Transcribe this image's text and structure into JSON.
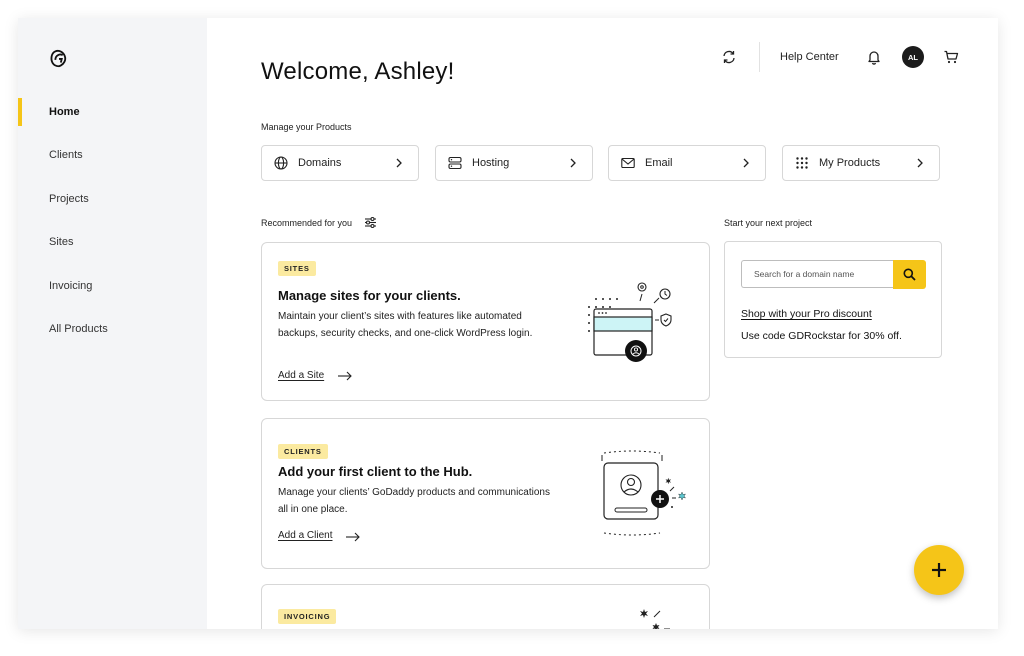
{
  "sidebar": {
    "items": [
      {
        "label": "Home",
        "active": true
      },
      {
        "label": "Clients",
        "active": false
      },
      {
        "label": "Projects",
        "active": false
      },
      {
        "label": "Sites",
        "active": false
      },
      {
        "label": "Invoicing",
        "active": false
      },
      {
        "label": "All Products",
        "active": false
      }
    ]
  },
  "header": {
    "help_label": "Help Center",
    "avatar_initials": "AL"
  },
  "main": {
    "welcome": "Welcome, Ashley!",
    "manage_label": "Manage your Products",
    "products": [
      {
        "label": "Domains",
        "icon": "globe-icon"
      },
      {
        "label": "Hosting",
        "icon": "server-icon"
      },
      {
        "label": "Email",
        "icon": "envelope-icon"
      },
      {
        "label": "My Products",
        "icon": "grid-icon"
      }
    ],
    "recommended_label": "Recommended for you",
    "cards": [
      {
        "badge": "SITES",
        "title": "Manage sites for your clients.",
        "description": "Maintain your client’s sites with features like automated backups, security checks, and one-click WordPress login.",
        "link": "Add a Site"
      },
      {
        "badge": "CLIENTS",
        "title": "Add your first client to the Hub.",
        "description": "Manage your clients’ GoDaddy products and communications all in one place.",
        "link": "Add a Client"
      },
      {
        "badge": "INVOICING"
      }
    ]
  },
  "project": {
    "label": "Start your next project",
    "search_placeholder": "Search for a domain name",
    "pro_link": "Shop with your Pro discount",
    "pro_code": "Use code GDRockstar for 30% off."
  },
  "colors": {
    "accent": "#f5c518",
    "badge_bg": "#fbeaa0",
    "sidebar_bg": "#f4f5f7",
    "illustration_fill": "#cdf4f6"
  }
}
